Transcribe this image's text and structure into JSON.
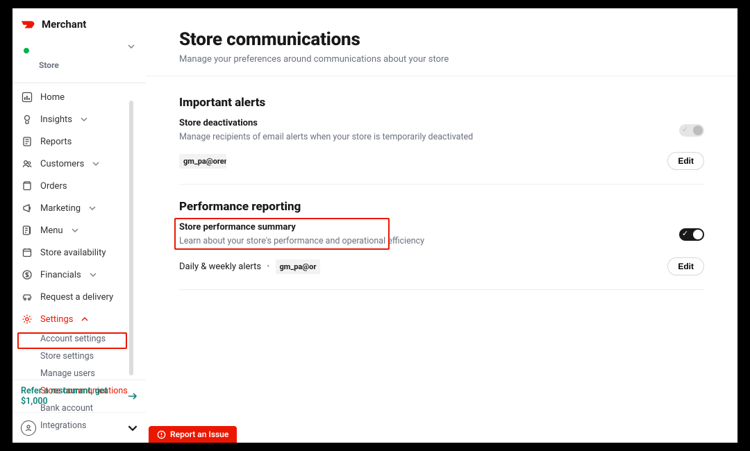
{
  "brand": {
    "name": "Merchant"
  },
  "store_picker": {
    "label": "Store"
  },
  "nav": {
    "home": "Home",
    "insights": "Insights",
    "reports": "Reports",
    "customers": "Customers",
    "orders": "Orders",
    "marketing": "Marketing",
    "menu": "Menu",
    "store_availability": "Store availability",
    "financials": "Financials",
    "request_delivery": "Request a delivery",
    "settings": "Settings"
  },
  "settings_sub": {
    "account": "Account settings",
    "store": "Store settings",
    "manage_users": "Manage users",
    "store_comms": "Store communications",
    "bank": "Bank account",
    "integrations": "Integrations"
  },
  "footer": {
    "refer": "Refer a restaurant, get $1,000"
  },
  "report_issue": "Report an Issue",
  "page": {
    "title": "Store communications",
    "subtitle": "Manage your preferences around communications about your store"
  },
  "alerts": {
    "heading": "Important alerts",
    "deactivations_label": "Store deactivations",
    "deactivations_desc": "Manage recipients of email alerts when your store is temporarily deactivated",
    "recipient_chip": "gm_pa@oren",
    "edit": "Edit"
  },
  "perf": {
    "heading": "Performance reporting",
    "summary_label": "Store performance summary",
    "summary_desc": "Learn about your store's performance and operational efficiency",
    "daily_label": "Daily & weekly alerts",
    "recipient_chip": "gm_pa@or",
    "edit": "Edit"
  }
}
